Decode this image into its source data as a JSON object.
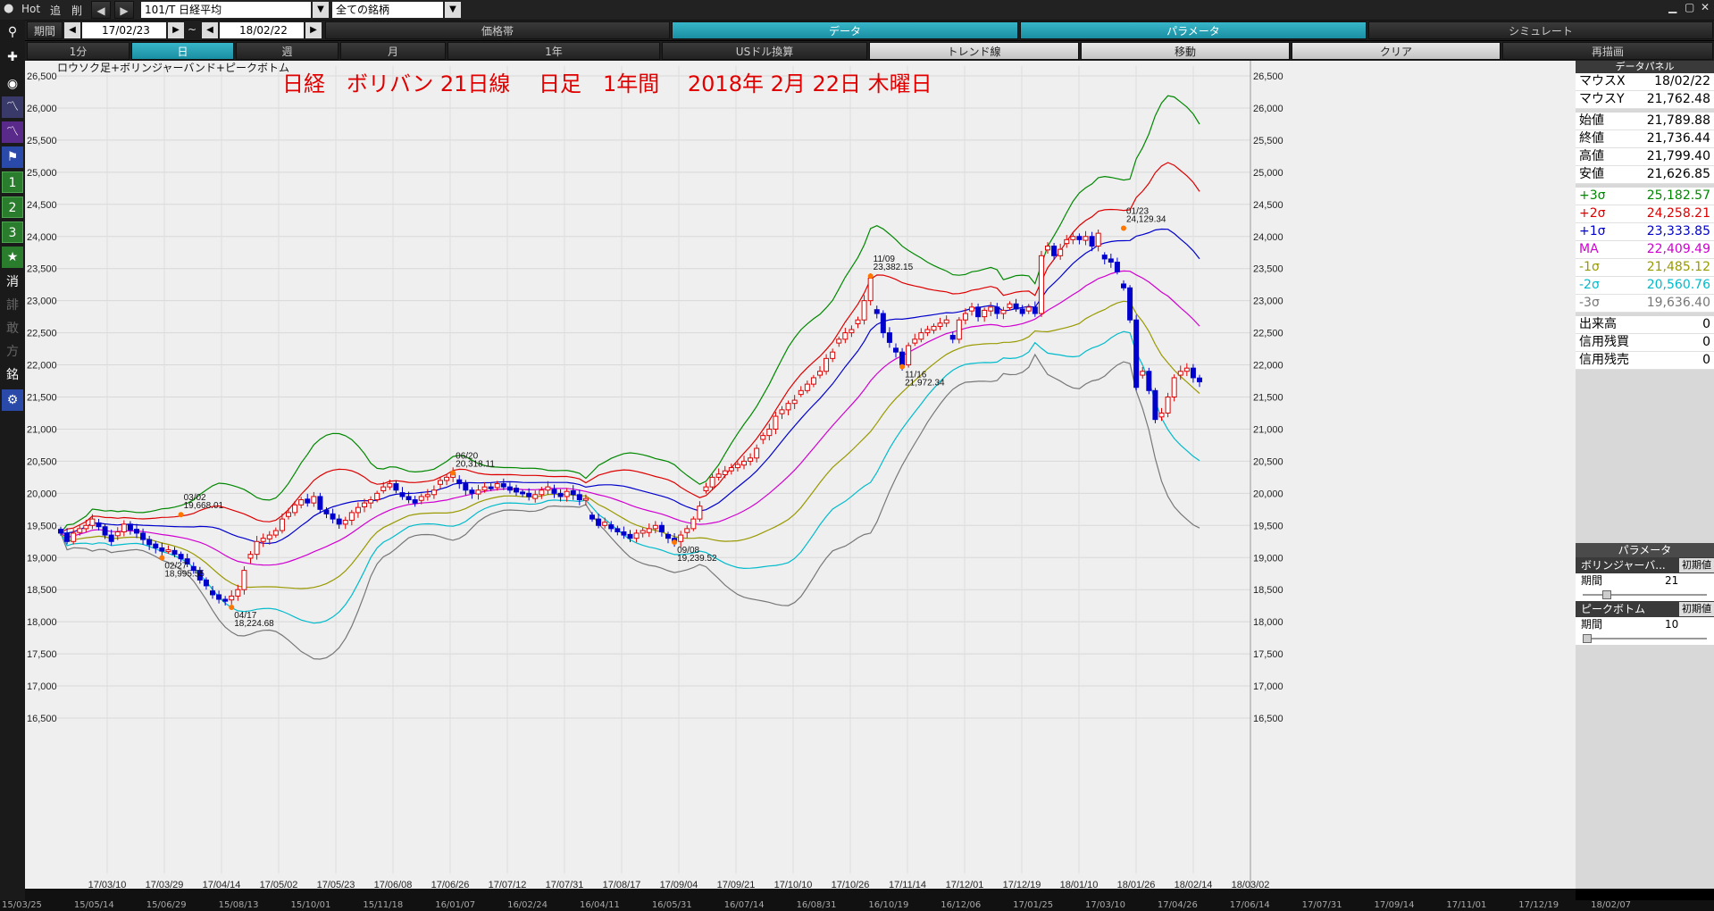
{
  "topbar": {
    "hot": "Hot",
    "add": "追",
    "del": "削",
    "symbol": "101/T 日経平均",
    "universe": "全ての銘柄",
    "tabs": [
      "価格帯",
      "データ",
      "パラメータ",
      "シミュレート"
    ]
  },
  "period_bar": {
    "label": "期間",
    "from": "17/02/23",
    "tilde": "~",
    "to": "18/02/22",
    "buttons": [
      "1分",
      "日",
      "週",
      "月",
      "1年",
      "USドル換算",
      "トレンド線",
      "移動",
      "クリア",
      "再描画"
    ],
    "active": "日"
  },
  "sidebar": {
    "numbers": [
      "1",
      "2",
      "3"
    ],
    "kanji": [
      "消",
      "誹",
      "敢",
      "方",
      "銘"
    ]
  },
  "chart_data": {
    "type": "candlestick",
    "header": "ロウソク足+ボリンジャーバンド+ピークボトム",
    "title": "日経　ボリバン 21日線　 日足　1年間　 2018年 2月 22日 木曜日",
    "ylim": [
      16500,
      26900
    ],
    "yticks": [
      "26,500",
      "26,000",
      "25,500",
      "25,000",
      "24,500",
      "24,000",
      "23,500",
      "23,000",
      "22,500",
      "22,000",
      "21,500",
      "21,000",
      "20,500",
      "20,000",
      "19,500",
      "19,000",
      "18,500",
      "18,000",
      "17,500",
      "17,000",
      "16,500"
    ],
    "xticks": [
      "17/03/10",
      "17/03/29",
      "17/04/14",
      "17/05/02",
      "17/05/23",
      "17/06/08",
      "17/06/26",
      "17/07/12",
      "17/07/31",
      "17/08/17",
      "17/09/04",
      "17/09/21",
      "17/10/10",
      "17/10/26",
      "17/11/14",
      "17/12/01",
      "17/12/19",
      "18/01/10",
      "18/01/26",
      "18/02/14",
      "18/03/02"
    ],
    "closes": [
      19380,
      19250,
      19380,
      19450,
      19500,
      19600,
      19480,
      19350,
      19250,
      19400,
      19520,
      19430,
      19380,
      19280,
      19200,
      19150,
      19100,
      19120,
      19050,
      18980,
      18900,
      18800,
      18650,
      18560,
      18420,
      18350,
      18320,
      18400,
      18500,
      18800,
      19050,
      19250,
      19300,
      19350,
      19420,
      19600,
      19700,
      19820,
      19900,
      19850,
      19950,
      19750,
      19680,
      19600,
      19520,
      19580,
      19700,
      19780,
      19850,
      19900,
      20000,
      20100,
      20150,
      20050,
      19950,
      19900,
      19850,
      19950,
      19980,
      20050,
      20200,
      20250,
      20320,
      20150,
      20050,
      20000,
      20050,
      20100,
      20080,
      20150,
      20100,
      20050,
      20020,
      20000,
      19950,
      19980,
      20050,
      20100,
      20000,
      19950,
      20030,
      19980,
      19900,
      19920,
      19600,
      19500,
      19550,
      19450,
      19400,
      19350,
      19300,
      19380,
      19420,
      19450,
      19500,
      19400,
      19300,
      19250,
      19350,
      19450,
      19600,
      19800,
      20100,
      20250,
      20300,
      20350,
      20400,
      20450,
      20500,
      20550,
      20700,
      20900,
      21000,
      21200,
      21300,
      21400,
      21450,
      21600,
      21700,
      21800,
      21900,
      22100,
      22200,
      22400,
      22500,
      22550,
      22700,
      23000,
      23350,
      22800,
      22500,
      22350,
      22200,
      22000,
      22300,
      22400,
      22500,
      22550,
      22600,
      22650,
      22700,
      22400,
      22700,
      22800,
      22900,
      22750,
      22850,
      22900,
      22800,
      22850,
      22950,
      22870,
      22800,
      22900,
      22800,
      23700,
      23850,
      23700,
      23800,
      23950,
      24000,
      23950,
      24000,
      23850,
      24050,
      23650,
      23600,
      23450,
      23200,
      22700,
      21650,
      21900,
      21600,
      21150,
      21250,
      21500,
      21800,
      21900,
      21950,
      21800,
      21736
    ],
    "bands": {
      "ma": "#d000d0",
      "p1": "#0000cc",
      "p2": "#dd0000",
      "p3": "#008800",
      "m1": "#999900",
      "m2": "#00bbcc",
      "m3": "#777777"
    },
    "annotations": [
      {
        "date": "03/02",
        "value": "19,668.01",
        "x": 19,
        "y": 19668,
        "kind": "peak"
      },
      {
        "date": "02/27",
        "value": "18,995.55",
        "x": 16,
        "y": 18995,
        "kind": "bottom"
      },
      {
        "date": "04/17",
        "value": "18,224.68",
        "x": 27,
        "y": 18224,
        "kind": "bottom"
      },
      {
        "date": "06/20",
        "value": "20,318.11",
        "x": 62,
        "y": 20318,
        "kind": "peak"
      },
      {
        "date": "09/08",
        "value": "19,239.52",
        "x": 97,
        "y": 19239,
        "kind": "bottom"
      },
      {
        "date": "11/09",
        "value": "23,382.15",
        "x": 128,
        "y": 23382,
        "kind": "peak"
      },
      {
        "date": "11/16",
        "value": "21,972.34",
        "x": 133,
        "y": 21972,
        "kind": "bottom"
      },
      {
        "date": "01/23",
        "value": "24,129.34",
        "x": 168,
        "y": 24129,
        "kind": "peak"
      }
    ]
  },
  "data_panel": {
    "title": "データパネル",
    "mouse": [
      {
        "k": "マウスX",
        "v": "18/02/22"
      },
      {
        "k": "マウスY",
        "v": "21,762.48"
      }
    ],
    "ohlc": [
      {
        "k": "始値",
        "v": "21,789.88"
      },
      {
        "k": "終値",
        "v": "21,736.44"
      },
      {
        "k": "高値",
        "v": "21,799.40"
      },
      {
        "k": "安値",
        "v": "21,626.85"
      }
    ],
    "bands": [
      {
        "k": "+3σ",
        "v": "25,182.57",
        "color": "#008800"
      },
      {
        "k": "+2σ",
        "v": "24,258.21",
        "color": "#dd0000"
      },
      {
        "k": "+1σ",
        "v": "23,333.85",
        "color": "#0000cc"
      },
      {
        "k": "MA",
        "v": "22,409.49",
        "color": "#d000d0"
      },
      {
        "k": "-1σ",
        "v": "21,485.12",
        "color": "#999900"
      },
      {
        "k": "-2σ",
        "v": "20,560.76",
        "color": "#00bbcc"
      },
      {
        "k": "-3σ",
        "v": "19,636.40",
        "color": "#777777"
      }
    ],
    "volume": [
      {
        "k": "出来高",
        "v": "0"
      },
      {
        "k": "信用残買",
        "v": "0"
      },
      {
        "k": "信用残売",
        "v": "0"
      }
    ]
  },
  "params": {
    "title": "パラメータ",
    "boll_name": "ボリンジャーバ...",
    "init": "初期値",
    "period_label": "期間",
    "boll_period": "21",
    "peak_name": "ピークボトム",
    "peak_period": "10"
  },
  "timeline": [
    "15/03/25",
    "15/05/14",
    "15/06/29",
    "15/08/13",
    "15/10/01",
    "15/11/18",
    "16/01/07",
    "16/02/24",
    "16/04/11",
    "16/05/31",
    "16/07/14",
    "16/08/31",
    "16/10/19",
    "16/12/06",
    "17/01/25",
    "17/03/10",
    "17/04/26",
    "17/06/14",
    "17/07/31",
    "17/09/14",
    "17/11/01",
    "17/12/19",
    "18/02/07"
  ]
}
